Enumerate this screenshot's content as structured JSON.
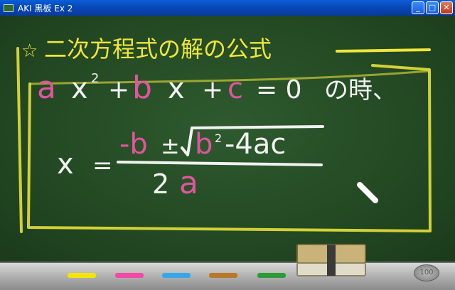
{
  "window": {
    "title": "AKI 黒板 Ex 2"
  },
  "controls": {
    "minimize": "_",
    "maximize": "□",
    "close": "✕"
  },
  "board": {
    "heading_star": "☆",
    "heading": "二次方程式の解の公式",
    "equation": {
      "a": "a",
      "x1": "x",
      "sq": "2",
      "plus1": "+",
      "b": "b",
      "x2": "x",
      "plus2": "+",
      "c": "c",
      "eq": "= 0",
      "tail": "の時、"
    },
    "formula": {
      "x": "x",
      "eq": "=",
      "neg_b": "-b",
      "pm": "±",
      "b2": "b",
      "sq": "2",
      "rest": "-4ac",
      "denom_2": "2",
      "denom_a": "a"
    }
  },
  "tray": {
    "chalks": [
      {
        "color": "#f4e400"
      },
      {
        "color": "#f24aa5"
      },
      {
        "color": "#35a9e8"
      },
      {
        "color": "#b87a28"
      },
      {
        "color": "#2f9a38"
      }
    ],
    "coin_label": "100"
  },
  "colors": {
    "white_chalk": "#f2f2f2",
    "yellow_chalk": "#efe63a",
    "pink_chalk": "#e0559e"
  }
}
